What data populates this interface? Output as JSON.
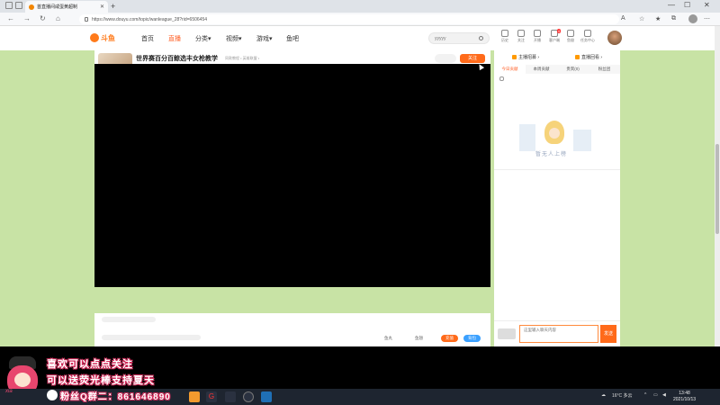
{
  "browser": {
    "tab_title": "首直播间咸蛋黄超制",
    "url": "https://www.douyu.com/topic/wanleague_28?rid=6506454"
  },
  "site": {
    "logo_text": "斗鱼",
    "nav": [
      "首页",
      "直播",
      "分类▾",
      "视频▾",
      "游戏▾",
      "鱼吧"
    ],
    "search_placeholder": "yyyyy",
    "header_icons": [
      {
        "label": "历史",
        "name": "history-icon"
      },
      {
        "label": "关注",
        "name": "follow-icon"
      },
      {
        "label": "开播",
        "name": "broadcast-icon"
      },
      {
        "label": "客户端",
        "name": "client-icon",
        "badge": "4"
      },
      {
        "label": "鱼翅",
        "name": "fishfin-icon"
      },
      {
        "label": "任务中心",
        "name": "task-icon"
      }
    ]
  },
  "room": {
    "title": "世界赛百分百鲸选丰女枪教学",
    "category": "同款教程 • 英雄联盟 •",
    "level": "LV3",
    "anchor_name": "翼天翼天 •",
    "heat": "0",
    "rank_badge": "英雄联盟一分榜",
    "meta": [
      "13 友间",
      "佳日互动",
      "162.2kg",
      "405 成就点"
    ],
    "follow_label": "关注",
    "vip_label": "VIP贵族",
    "share_label": "分享",
    "report_label": "爆料违规",
    "pic_caption": "鱼吧  1 公告"
  },
  "right_panel": {
    "anchor_task": "主播招募 ›",
    "anchor_review": "直播回看 ›",
    "tabs": [
      "今日贡献",
      "本周贡献",
      "贵宾(0)",
      "粉丝团"
    ],
    "empty_caption": "暂无人上榜",
    "block_label": "屏蔽特效",
    "chat_placeholder": "这里输入聊天内容",
    "send_label": "发送"
  },
  "gift_bar": {
    "items": [
      "鱼丸",
      "鱼翅"
    ],
    "btn_buy": "充值",
    "btn_bag": "背包"
  },
  "overlay": {
    "line1": "喜欢可以点点关注",
    "line2": "可以送荧光棒支持夏天",
    "line3": "粉丝Q群二：861646890",
    "brand": "xia"
  },
  "taskbar": {
    "weather": "16°C 多云",
    "time": "13:48",
    "date": "2021/10/13"
  }
}
